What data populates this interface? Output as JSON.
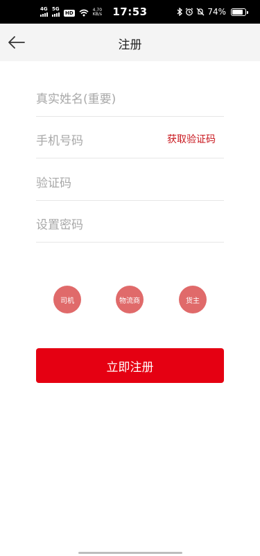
{
  "status_bar": {
    "net1": "4G",
    "net2": "5G",
    "hd": "HD",
    "speed_value": "4.70",
    "speed_unit": "KB/s",
    "time": "17:53",
    "battery": "74%"
  },
  "header": {
    "title": "注册"
  },
  "form": {
    "name_placeholder": "真实姓名(重要)",
    "phone_placeholder": "手机号码",
    "get_code_label": "获取验证码",
    "code_placeholder": "验证码",
    "password_placeholder": "设置密码"
  },
  "roles": [
    {
      "label": "司机"
    },
    {
      "label": "物流商"
    },
    {
      "label": "货主"
    }
  ],
  "submit_label": "立即注册",
  "colors": {
    "accent": "#e50012",
    "role_bg": "#e06a6a",
    "link": "#c8161d"
  }
}
